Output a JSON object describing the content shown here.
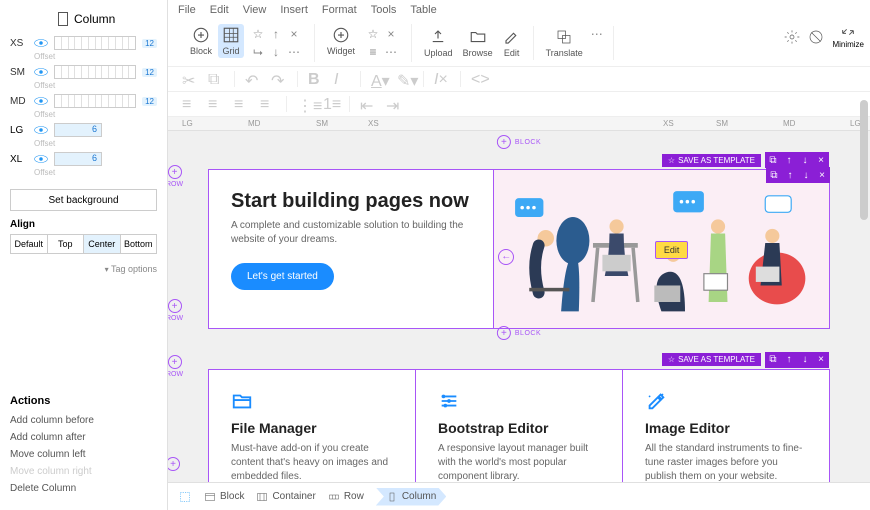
{
  "sidebar": {
    "title": "Column",
    "breakpoints": [
      {
        "label": "XS",
        "tag": "12",
        "offset": "Offset"
      },
      {
        "label": "SM",
        "tag": "12",
        "offset": "Offset"
      },
      {
        "label": "MD",
        "tag": "12",
        "offset": "Offset"
      }
    ],
    "single_breakpoints": [
      {
        "label": "LG",
        "value": "6",
        "offset": "Offset"
      },
      {
        "label": "XL",
        "value": "6",
        "offset": "Offset"
      }
    ],
    "set_bg": "Set background",
    "align_label": "Align",
    "align": [
      "Default",
      "Top",
      "Center",
      "Bottom"
    ],
    "align_active": 2,
    "tag_options": "Tag options",
    "actions_title": "Actions",
    "actions": [
      {
        "label": "Add column before",
        "disabled": false
      },
      {
        "label": "Add column after",
        "disabled": false
      },
      {
        "label": "Move column left",
        "disabled": false
      },
      {
        "label": "Move column right",
        "disabled": true
      },
      {
        "label": "Delete Column",
        "disabled": false
      }
    ]
  },
  "menubar": [
    "File",
    "Edit",
    "View",
    "Insert",
    "Format",
    "Tools",
    "Table"
  ],
  "toolbar": {
    "block": "Block",
    "grid": "Grid",
    "widget": "Widget",
    "upload": "Upload",
    "browse": "Browse",
    "edit": "Edit",
    "translate": "Translate",
    "minimize": "Minimize"
  },
  "ruler": [
    "LG",
    "MD",
    "SM",
    "XS",
    "XS",
    "SM",
    "MD",
    "LG"
  ],
  "canvas": {
    "block_label": "BLOCK",
    "row_label": "ROW",
    "save_template": "SAVE AS TEMPLATE",
    "hero": {
      "title": "Start building pages now",
      "subtitle": "A complete and customizable solution to building the website of your dreams.",
      "cta": "Let's get started",
      "edit_badge": "Edit"
    },
    "features": [
      {
        "title": "File Manager",
        "desc": "Must-have add-on if you create content that's heavy on images and embedded files."
      },
      {
        "title": "Bootstrap Editor",
        "desc": "A responsive layout manager built with the world's most popular component library."
      },
      {
        "title": "Image Editor",
        "desc": "All the standard instruments to fine-tune raster images before you publish them on your website."
      }
    ]
  },
  "crumbs": [
    "Block",
    "Container",
    "Row",
    "Column"
  ]
}
